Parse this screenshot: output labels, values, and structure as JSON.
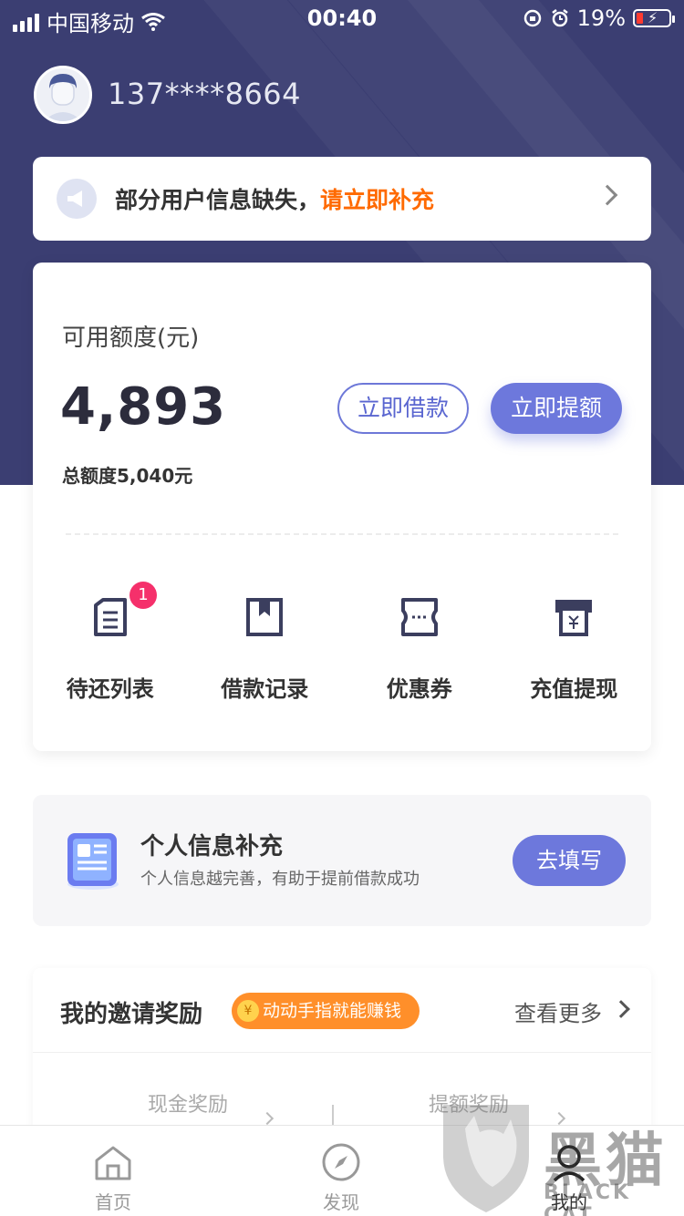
{
  "status_bar": {
    "carrier": "中国移动",
    "time": "00:40",
    "battery_percent": "19%",
    "battery_color": "#ff3b30"
  },
  "header": {
    "phone": "137****8664",
    "hero_color": "#3b3e72"
  },
  "notice": {
    "text": "部分用户信息缺失，",
    "highlight": "请立即补充",
    "highlight_color": "#ff6a00"
  },
  "credit": {
    "label": "可用额度(元)",
    "amount": "4,893",
    "total": "总额度5,040元",
    "borrow_button": "立即借款",
    "raise_button": "立即提额",
    "accent_color": "#6d78dc"
  },
  "menu": [
    {
      "label": "待还列表",
      "icon": "repay-list-icon",
      "badge": "1"
    },
    {
      "label": "借款记录",
      "icon": "loan-record-icon"
    },
    {
      "label": "优惠券",
      "icon": "coupon-icon"
    },
    {
      "label": "充值提现",
      "icon": "recharge-withdraw-icon"
    }
  ],
  "info_card": {
    "title": "个人信息补充",
    "subtitle": "个人信息越完善，有助于提前借款成功",
    "button": "去填写"
  },
  "invite": {
    "title": "我的邀请奖励",
    "tag_coin": "¥",
    "tag": "动动手指就能赚钱",
    "more": "查看更多",
    "rewards": [
      "现金奖励",
      "提额奖励"
    ]
  },
  "tabs": [
    {
      "label": "首页",
      "icon": "home-icon"
    },
    {
      "label": "发现",
      "icon": "discover-icon"
    },
    {
      "label": "我的",
      "icon": "profile-icon",
      "active": true
    }
  ],
  "watermark": {
    "text": "黑猫",
    "sub": "BLACK CAT"
  }
}
